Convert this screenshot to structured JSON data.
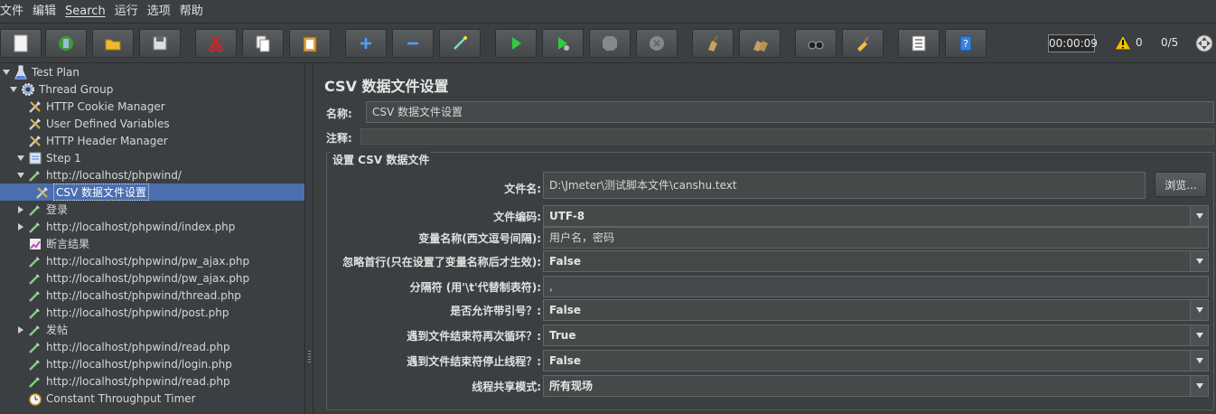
{
  "menu": [
    "文件",
    "编辑",
    "Search",
    "运行",
    "选项",
    "帮助"
  ],
  "toolbar": {
    "timer": "00:00:09",
    "warnings": "0",
    "threads": "0/5"
  },
  "tree": [
    {
      "label": "Test Plan",
      "depth": 0,
      "arrow": "down",
      "icon": "flask"
    },
    {
      "label": "Thread Group",
      "depth": 1,
      "arrow": "down",
      "icon": "gear"
    },
    {
      "label": "HTTP Cookie Manager",
      "depth": 2,
      "arrow": "none",
      "icon": "wrench"
    },
    {
      "label": "User Defined Variables",
      "depth": 2,
      "arrow": "none",
      "icon": "wrench"
    },
    {
      "label": "HTTP Header Manager",
      "depth": 2,
      "arrow": "none",
      "icon": "wrench"
    },
    {
      "label": "Step 1",
      "depth": 2,
      "arrow": "down",
      "icon": "step"
    },
    {
      "label": "http://localhost/phpwind/",
      "depth": 3,
      "arrow": "down",
      "icon": "pipette"
    },
    {
      "label": "CSV 数据文件设置",
      "depth": 4,
      "arrow": "none",
      "icon": "wrench",
      "selected": true
    },
    {
      "label": "登录",
      "depth": 3,
      "arrow": "right",
      "icon": "pipette"
    },
    {
      "label": "http://localhost/phpwind/index.php",
      "depth": 3,
      "arrow": "right",
      "icon": "pipette"
    },
    {
      "label": "断言结果",
      "depth": 3,
      "arrow": "none",
      "icon": "chart"
    },
    {
      "label": "http://localhost/phpwind/pw_ajax.php",
      "depth": 3,
      "arrow": "none",
      "icon": "pipette"
    },
    {
      "label": "http://localhost/phpwind/pw_ajax.php",
      "depth": 3,
      "arrow": "none",
      "icon": "pipette"
    },
    {
      "label": "http://localhost/phpwind/thread.php",
      "depth": 3,
      "arrow": "none",
      "icon": "pipette"
    },
    {
      "label": "http://localhost/phpwind/post.php",
      "depth": 3,
      "arrow": "none",
      "icon": "pipette"
    },
    {
      "label": "发帖",
      "depth": 3,
      "arrow": "right",
      "icon": "pipette"
    },
    {
      "label": "http://localhost/phpwind/read.php",
      "depth": 3,
      "arrow": "none",
      "icon": "pipette"
    },
    {
      "label": "http://localhost/phpwind/login.php",
      "depth": 3,
      "arrow": "none",
      "icon": "pipette"
    },
    {
      "label": "http://localhost/phpwind/read.php",
      "depth": 3,
      "arrow": "none",
      "icon": "pipette"
    },
    {
      "label": "Constant Throughput Timer",
      "depth": 3,
      "arrow": "none",
      "icon": "timer"
    }
  ],
  "panel": {
    "title": "CSV 数据文件设置",
    "name_label": "名称:",
    "name_value": "CSV 数据文件设置",
    "comment_label": "注释:",
    "group_title": "设置 CSV 数据文件",
    "browse_label": "浏览...",
    "rows": [
      {
        "label": "文件名:",
        "value": "D:\\Jmeter\\测试脚本文件\\canshu.text",
        "kind": "text"
      },
      {
        "label": "文件编码:",
        "value": "UTF-8",
        "kind": "combo"
      },
      {
        "label": "变量名称(西文逗号间隔):",
        "value": "用户名，密码",
        "kind": "text"
      },
      {
        "label": "忽略首行(只在设置了变量名称后才生效):",
        "value": "False",
        "kind": "combo"
      },
      {
        "label": "分隔符 (用'\\t'代替制表符):",
        "value": ",",
        "kind": "text"
      },
      {
        "label": "是否允许带引号？:",
        "value": "False",
        "kind": "combo"
      },
      {
        "label": "遇到文件结束符再次循环？:",
        "value": "True",
        "kind": "combo"
      },
      {
        "label": "遇到文件结束符停止线程？:",
        "value": "False",
        "kind": "combo"
      },
      {
        "label": "线程共享模式:",
        "value": "所有现场",
        "kind": "combo"
      }
    ]
  },
  "colors": {
    "background": "#3c3f41",
    "selection": "#4b6eaf",
    "run_green": "#2ecc40",
    "warning_yellow": "#f0c000"
  }
}
